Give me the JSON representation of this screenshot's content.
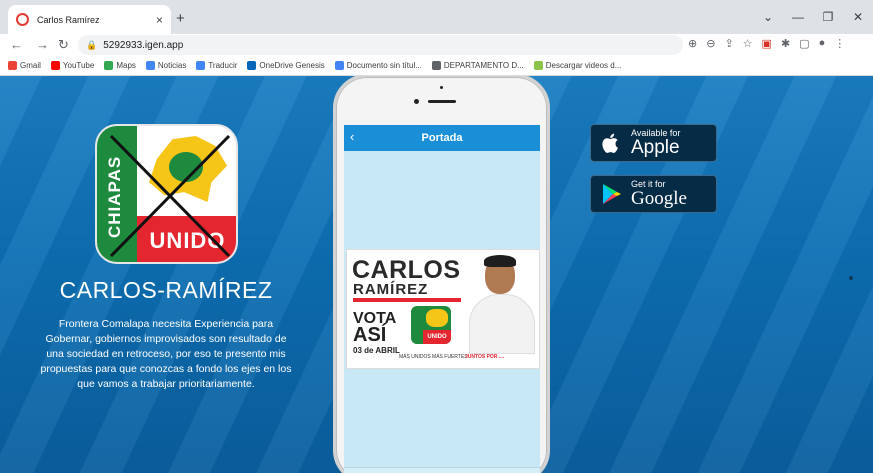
{
  "browser": {
    "tab_title": "Carlos Ramírez",
    "tab_close": "×",
    "new_tab": "+",
    "url": "5292933.igen.app",
    "win_minimize": "—",
    "win_restore": "❐",
    "win_close": "✕",
    "win_chevron": "⌄"
  },
  "bookmarks": [
    {
      "label": "Gmail",
      "icon": "gmail-icon",
      "color": "#ea4335"
    },
    {
      "label": "YouTube",
      "icon": "youtube-icon",
      "color": "#ff0000"
    },
    {
      "label": "Maps",
      "icon": "maps-icon",
      "color": "#34a853"
    },
    {
      "label": "Noticias",
      "icon": "news-icon",
      "color": "#4285f4"
    },
    {
      "label": "Traducir",
      "icon": "translate-icon",
      "color": "#4285f4"
    },
    {
      "label": "OneDrive Genesis",
      "icon": "onedrive-icon",
      "color": "#0364b8"
    },
    {
      "label": "Documento sin títul...",
      "icon": "docs-icon",
      "color": "#4285f4"
    },
    {
      "label": "DEPARTAMENTO D...",
      "icon": "globe-icon",
      "color": "#5f6368"
    },
    {
      "label": "Descargar videos d...",
      "icon": "download-icon",
      "color": "#8bc34a"
    }
  ],
  "page": {
    "candidate_name": "CARLOS-RAMÍREZ",
    "description": "Frontera Comalapa necesita Experiencia para Gobernar, gobiernos improvisados son resultado de una sociedad en retroceso, por eso te presento mis propuestas para que conozcas a fondo los ejes en los que vamos a trabajar prioritariamente.",
    "logo_party_left": "CHIAPAS",
    "logo_party_bottom": "UNIDO"
  },
  "app": {
    "header_title": "Portada",
    "back_icon": "‹",
    "banner": {
      "first_name": "CARLOS",
      "last_name": "RAMÍREZ",
      "vota": "VOTA",
      "asi": "ASÍ",
      "date": "03 de ABRIL",
      "logo_text": "UNIDO",
      "tagline": "MÁS UNIDOS MÁS FUERTES",
      "footer": "JUNTOS POR ...."
    }
  },
  "stores": {
    "apple_small": "Available for",
    "apple_big": "Apple",
    "google_small": "Get it for",
    "google_big": "Google"
  },
  "colors": {
    "page_blue": "#0d6fb3",
    "app_header": "#1a8ed6",
    "party_green": "#1d8a3e",
    "party_red": "#e3262f",
    "party_yellow": "#f5c518"
  }
}
